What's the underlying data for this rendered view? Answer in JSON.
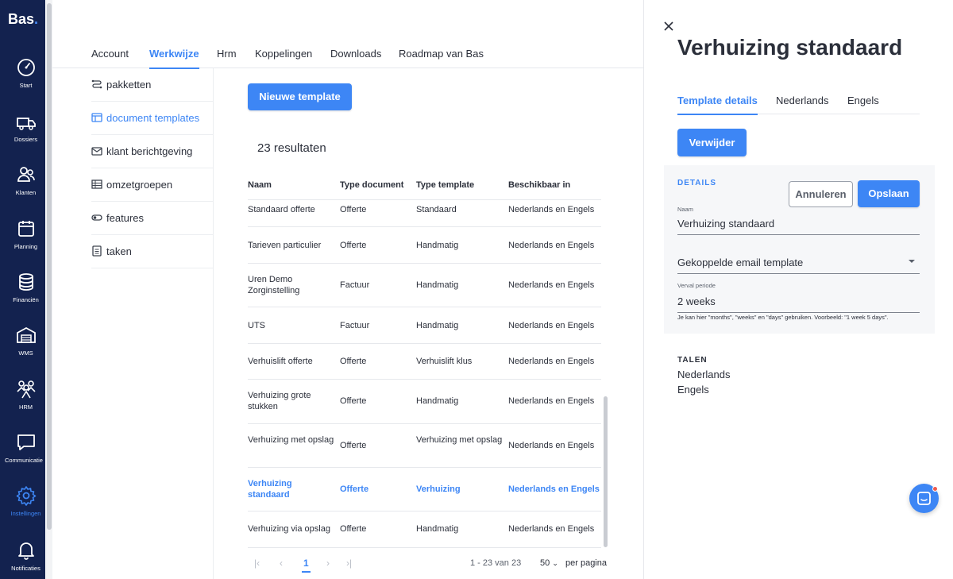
{
  "app": {
    "logo": "Bas",
    "logo_dot": "."
  },
  "nav": {
    "items": [
      {
        "label": "Start",
        "icon": "dashboard-gauge-icon"
      },
      {
        "label": "Dossiers",
        "icon": "truck-icon"
      },
      {
        "label": "Klanten",
        "icon": "users-icon"
      },
      {
        "label": "Planning",
        "icon": "calendar-icon"
      },
      {
        "label": "Financiën",
        "icon": "coins-icon"
      },
      {
        "label": "WMS",
        "icon": "warehouse-icon"
      },
      {
        "label": "HRM",
        "icon": "team-icon"
      },
      {
        "label": "Communicatie",
        "icon": "chat-bubble-icon"
      },
      {
        "label": "Instellingen",
        "icon": "gear-icon",
        "active": true
      },
      {
        "label": "Notificaties",
        "icon": "bell-icon"
      }
    ]
  },
  "tabs": [
    "Account",
    "Werkwijze",
    "Hrm",
    "Koppelingen",
    "Downloads",
    "Roadmap van Bas"
  ],
  "active_tab": "Werkwijze",
  "submenu": [
    {
      "label": "pakketten",
      "icon": "route-icon"
    },
    {
      "label": "document templates",
      "icon": "template-icon",
      "active": true
    },
    {
      "label": "klant berichtgeving",
      "icon": "envelope-icon"
    },
    {
      "label": "omzetgroepen",
      "icon": "table-icon"
    },
    {
      "label": "features",
      "icon": "toggle-icon"
    },
    {
      "label": "taken",
      "icon": "checklist-icon"
    }
  ],
  "main": {
    "new_button": "Nieuwe template",
    "results_label": "23 resultaten"
  },
  "table": {
    "headers": [
      "Naam",
      "Type document",
      "Type template",
      "Beschikbaar in"
    ],
    "rows": [
      {
        "naam": "Standaard offerte",
        "doc": "Offerte",
        "tpl": "Standaard",
        "beschikbaar": "Nederlands en Engels"
      },
      {
        "naam": "Tarieven particulier",
        "doc": "Offerte",
        "tpl": "Handmatig",
        "beschikbaar": "Nederlands en Engels"
      },
      {
        "naam": "Uren Demo Zorginstelling",
        "doc": "Factuur",
        "tpl": "Handmatig",
        "beschikbaar": "Nederlands en Engels"
      },
      {
        "naam": "UTS",
        "doc": "Factuur",
        "tpl": "Handmatig",
        "beschikbaar": "Nederlands en Engels"
      },
      {
        "naam": "Verhuislift offerte",
        "doc": "Offerte",
        "tpl": "Verhuislift klus",
        "beschikbaar": "Nederlands en Engels"
      },
      {
        "naam": "Verhuizing grote stukken",
        "doc": "Offerte",
        "tpl": "Handmatig",
        "beschikbaar": "Nederlands en Engels"
      },
      {
        "naam": "Verhuizing met opslag",
        "doc": "Offerte",
        "tpl": "Verhuizing met opslag",
        "beschikbaar": "Nederlands en Engels"
      },
      {
        "naam": "Verhuizing standaard",
        "doc": "Offerte",
        "tpl": "Verhuizing",
        "beschikbaar": "Nederlands en Engels",
        "selected": true
      },
      {
        "naam": "Verhuizing via opslag",
        "doc": "Offerte",
        "tpl": "Handmatig",
        "beschikbaar": "Nederlands en Engels"
      }
    ]
  },
  "pagination": {
    "current_page": "1",
    "range": "1 - 23 van 23",
    "per_page": "50",
    "per_page_label": "per pagina"
  },
  "panel": {
    "title": "Verhuizing standaard",
    "tabs": [
      "Template details",
      "Nederlands",
      "Engels"
    ],
    "active_tab": "Template details",
    "delete_button": "Verwijder",
    "details_title": "DETAILS",
    "cancel_button": "Annuleren",
    "save_button": "Opslaan",
    "name_label": "Naam",
    "name_value": "Verhuizing standaard",
    "email_template_placeholder": "Gekoppelde email template",
    "verval_label": "Verval periode",
    "verval_value": "2 weeks",
    "hint": "Je kan hier \"months\", \"weeks\" en \"days\" gebruiken. Voorbeeld: \"1 week 5 days\".",
    "talen_title": "TALEN",
    "talen": [
      "Nederlands",
      "Engels"
    ]
  },
  "colors": {
    "accent": "#3d86f5",
    "nav_bg": "#13224f",
    "notification_dot": "#f05a4c"
  }
}
